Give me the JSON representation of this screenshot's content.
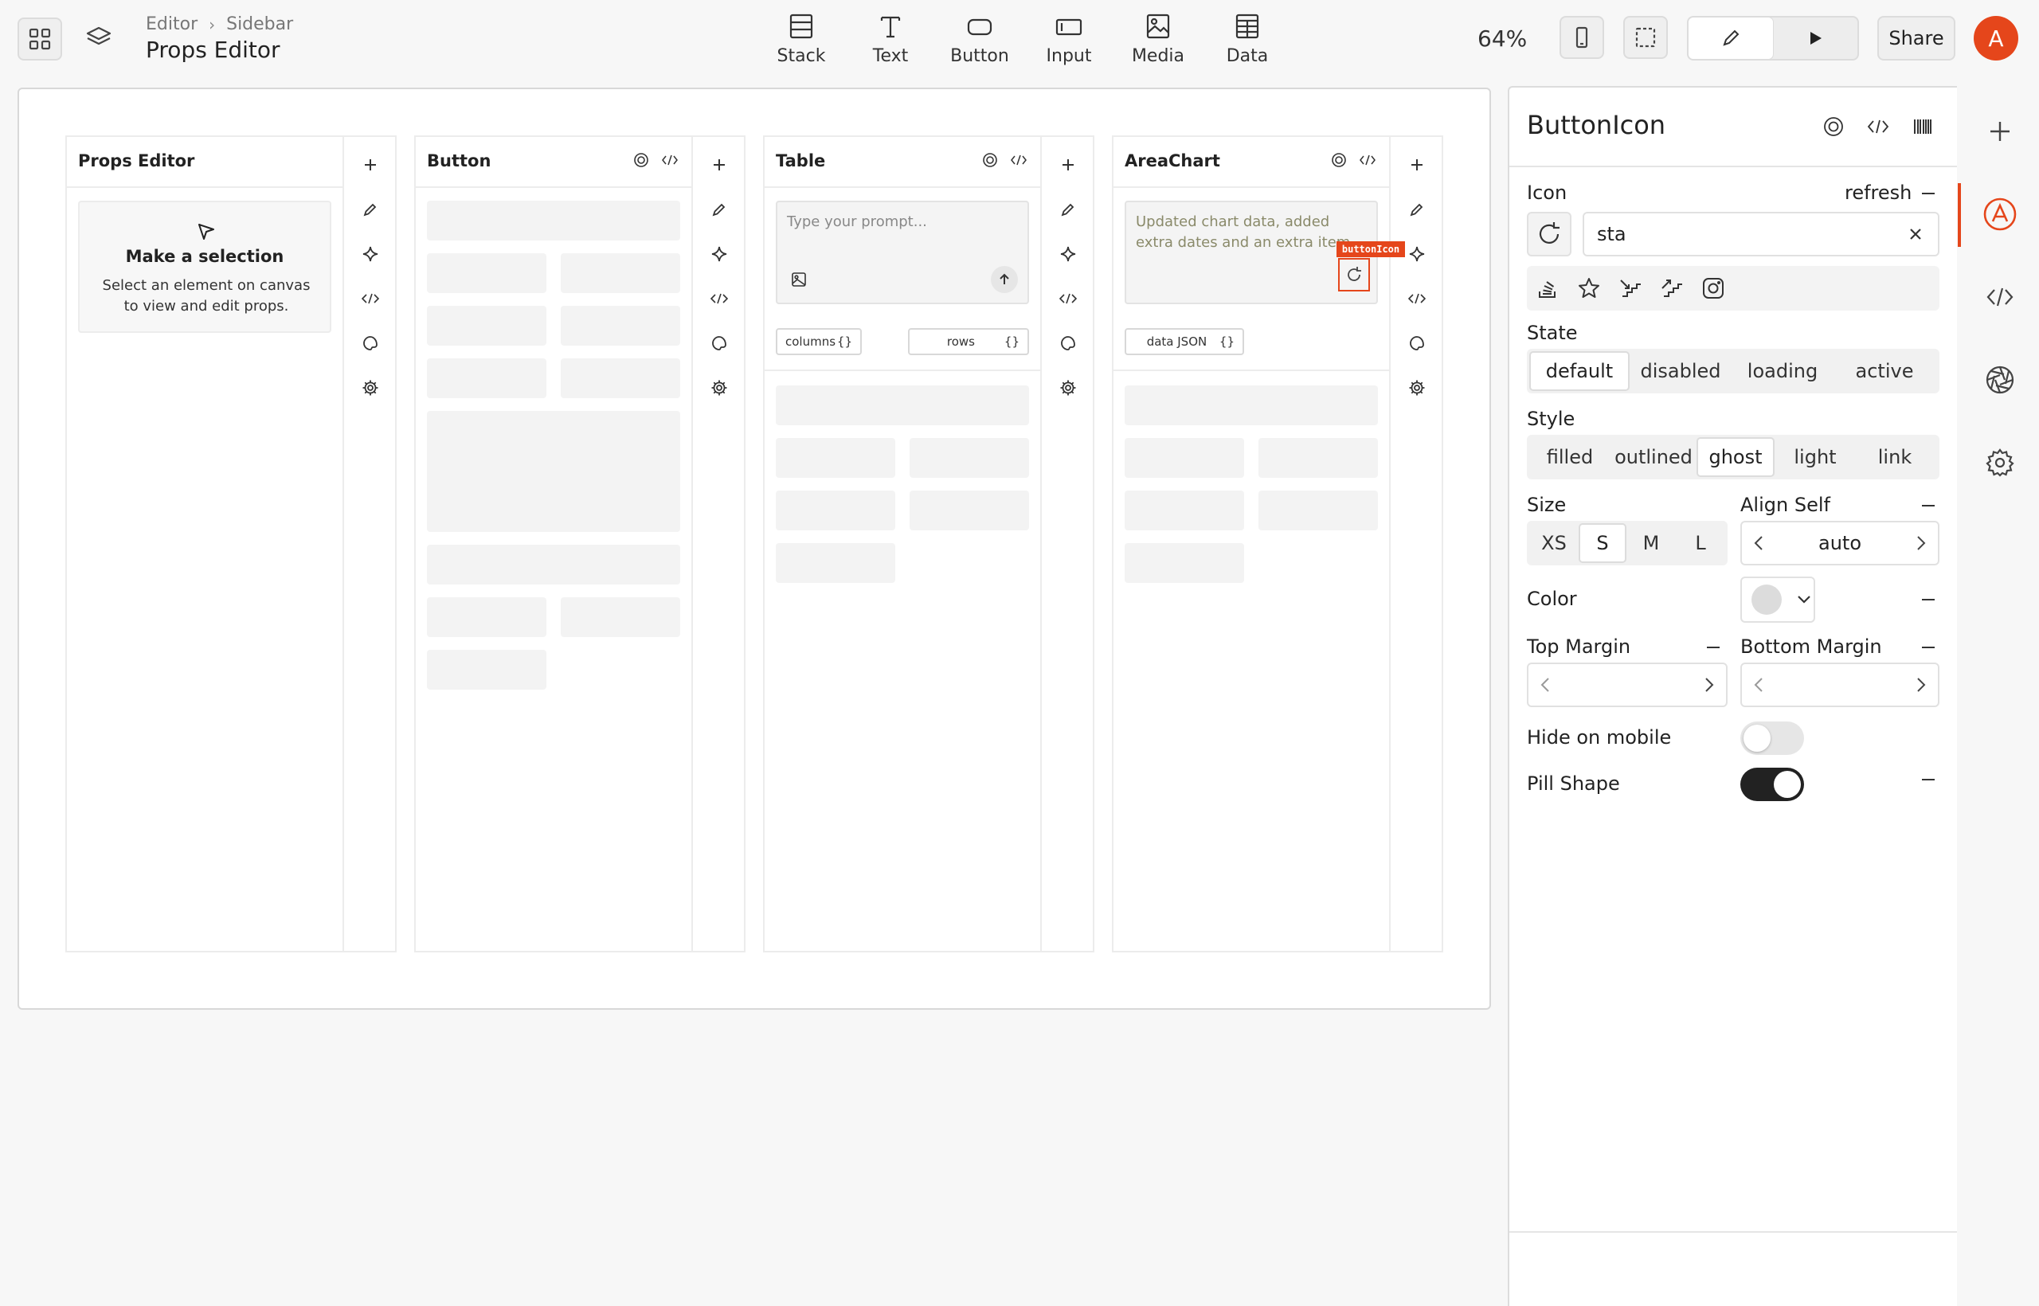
{
  "topbar": {
    "breadcrumb": [
      "Editor",
      "Sidebar"
    ],
    "page_title": "Props Editor",
    "tools": [
      {
        "label": "Stack",
        "icon": "stack-icon"
      },
      {
        "label": "Text",
        "icon": "text-icon"
      },
      {
        "label": "Button",
        "icon": "button-icon"
      },
      {
        "label": "Input",
        "icon": "input-icon"
      },
      {
        "label": "Media",
        "icon": "media-icon"
      },
      {
        "label": "Data",
        "icon": "data-table-icon"
      }
    ],
    "zoom": "64%",
    "share_label": "Share",
    "avatar_initial": "A"
  },
  "canvas": {
    "panels": [
      {
        "title": "Props Editor"
      },
      {
        "title": "Button"
      },
      {
        "title": "Table"
      },
      {
        "title": "AreaChart"
      }
    ],
    "selection_card": {
      "title": "Make a selection",
      "description": "Select an element on canvas to view and edit props."
    },
    "table_prompt_placeholder": "Type your prompt...",
    "table_chips": [
      {
        "label": "columns",
        "value": "{}"
      },
      {
        "label": "rows",
        "value": "{}"
      }
    ],
    "chart_prompt_text": "Updated chart data, added extra dates and an extra item.",
    "chart_chip": {
      "label": "data JSON",
      "value": "{}"
    },
    "selection_tag": "buttonIcon"
  },
  "inspector": {
    "title": "ButtonIcon",
    "icon_label": "Icon",
    "icon_value": "refresh",
    "icon_search_value": "sta",
    "icon_results": [
      "stack-overflow-icon",
      "star-icon",
      "stairs-down-icon",
      "stairs-up-icon",
      "instagram-icon"
    ],
    "state_label": "State",
    "state_options": [
      "default",
      "disabled",
      "loading",
      "active"
    ],
    "state_selected": "default",
    "style_label": "Style",
    "style_options": [
      "filled",
      "outlined",
      "ghost",
      "light",
      "link"
    ],
    "style_selected": "ghost",
    "size_label": "Size",
    "size_options": [
      "XS",
      "S",
      "M",
      "L"
    ],
    "size_selected": "S",
    "align_self_label": "Align Self",
    "align_self_value": "auto",
    "color_label": "Color",
    "color_swatch": "#dcdcdc",
    "top_margin_label": "Top Margin",
    "bottom_margin_label": "Bottom Margin",
    "hide_mobile_label": "Hide on mobile",
    "hide_mobile_on": false,
    "pill_shape_label": "Pill Shape",
    "pill_shape_on": true
  },
  "colors": {
    "accent": "#e5461b",
    "toggle_on": "#222222",
    "toggle_off": "#e6e6e6"
  }
}
